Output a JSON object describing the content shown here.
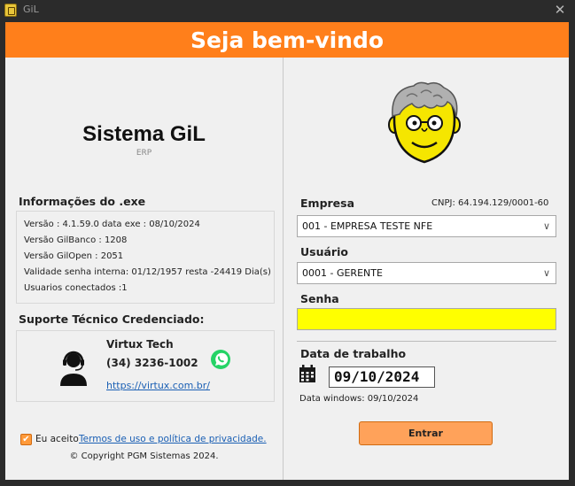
{
  "window": {
    "title": "GiL",
    "close_glyph": "✕"
  },
  "banner": {
    "title": "Seja bem-vindo",
    "color": "#ff7f1b"
  },
  "left": {
    "system_title": "Sistema GiL",
    "system_subtitle": "ERP",
    "info_heading": "Informações do .exe",
    "info_lines": [
      "Versão : 4.1.59.0 data exe : 08/10/2024",
      "Versão GilBanco : 1208",
      "Versão GilOpen  : 2051",
      "Validade senha interna: 01/12/1957 resta -24419 Dia(s)",
      "Usuarios conectados :1"
    ],
    "support_heading": "Suporte Técnico Credenciado:",
    "support": {
      "name": "Virtux Tech",
      "phone": "(34) 3236-1002",
      "link": "https://virtux.com.br/",
      "agent_icon": "support-agent-icon",
      "whatsapp_icon": "whatsapp-icon"
    },
    "accept": {
      "checked": true,
      "prefix": "Eu aceito",
      "link": "Termos de uso e política de privacidade."
    },
    "copyright": "© Copyright PGM Sistemas 2024."
  },
  "right": {
    "mascot_icon": "gil-mascot-icon",
    "empresa_label": "Empresa",
    "cnpj": "CNPJ:  64.194.129/0001-60",
    "empresa_value": "001 - EMPRESA TESTE NFE",
    "usuario_label": "Usuário",
    "usuario_value": "0001 - GERENTE",
    "senha_label": "Senha",
    "senha_value": "",
    "data_label": "Data de trabalho",
    "data_value": "09/10/2024",
    "data_windows": "Data windows: 09/10/2024",
    "enter_label": "Entrar",
    "chevron": "∨"
  }
}
